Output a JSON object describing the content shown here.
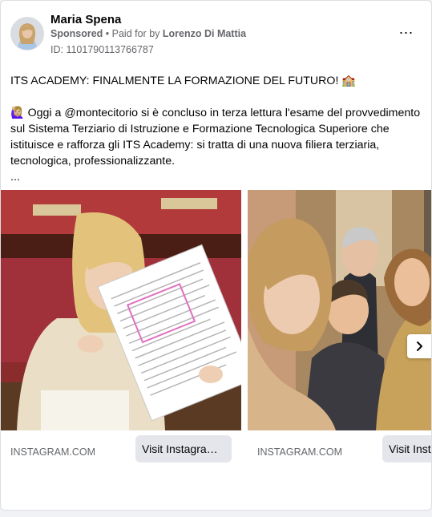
{
  "post": {
    "author_name": "Maria Spena",
    "sponsored_label": "Sponsored",
    "paid_for_prefix": "Paid for by",
    "payer_name": "Lorenzo Di Mattia",
    "ad_id": "ID: 1101790113766787",
    "more_icon": "⋯",
    "headline": "ITS ACADEMY: FINALMENTE LA FORMAZIONE DEL FUTURO! 🏫",
    "body": "🙋🏼‍♀️ Oggi a @montecitorio si è concluso in terza lettura l'esame del provvedimento sul Sistema Terziario di Istruzione e Formazione Tecnologica Superiore che istituisce e rafforza gli ITS Academy: si tratta di una nuova filiera terziaria, tecnologica, professionalizzante.",
    "ellipsis": "..."
  },
  "carousel": {
    "cards": [
      {
        "domain": "INSTAGRAM.COM",
        "cta": "Visit Instagram profile"
      },
      {
        "domain": "INSTAGRAM.COM",
        "cta": "Visit Instagram profile"
      }
    ],
    "next_icon": "chevron-right-icon"
  },
  "colors": {
    "card_bg": "#ffffff",
    "secondary_text": "#65676b",
    "button_bg": "#e4e6eb",
    "page_bg": "#f0f2f5"
  }
}
